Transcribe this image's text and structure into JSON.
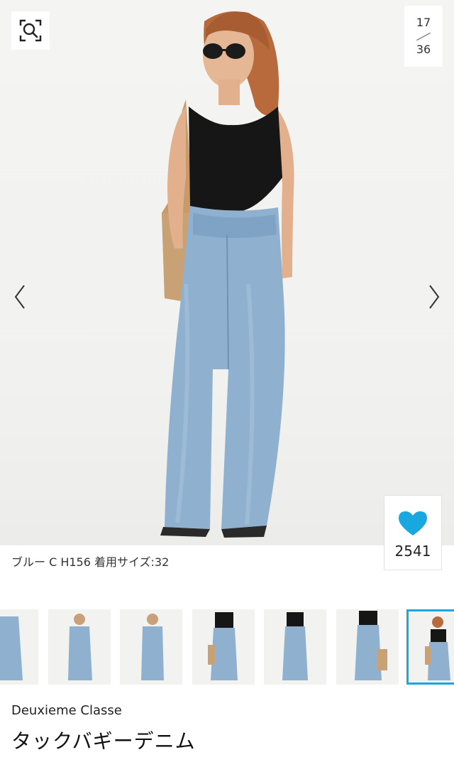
{
  "gallery": {
    "current": "17",
    "total": "36",
    "zoom_icon": "search-zoom-icon",
    "prev_icon": "chevron-left-icon",
    "next_icon": "chevron-right-icon",
    "favorite_count": "2541",
    "favorite_icon": "heart-icon",
    "favorite_color": "#19a7df"
  },
  "caption": "ブルー C H156 着用サイズ:32",
  "thumbnails": {
    "count_visible": 7,
    "active_index": 6,
    "active_border_color": "#19a7df"
  },
  "product": {
    "brand": "Deuxieme Classe",
    "name": "タックバギーデニム"
  }
}
